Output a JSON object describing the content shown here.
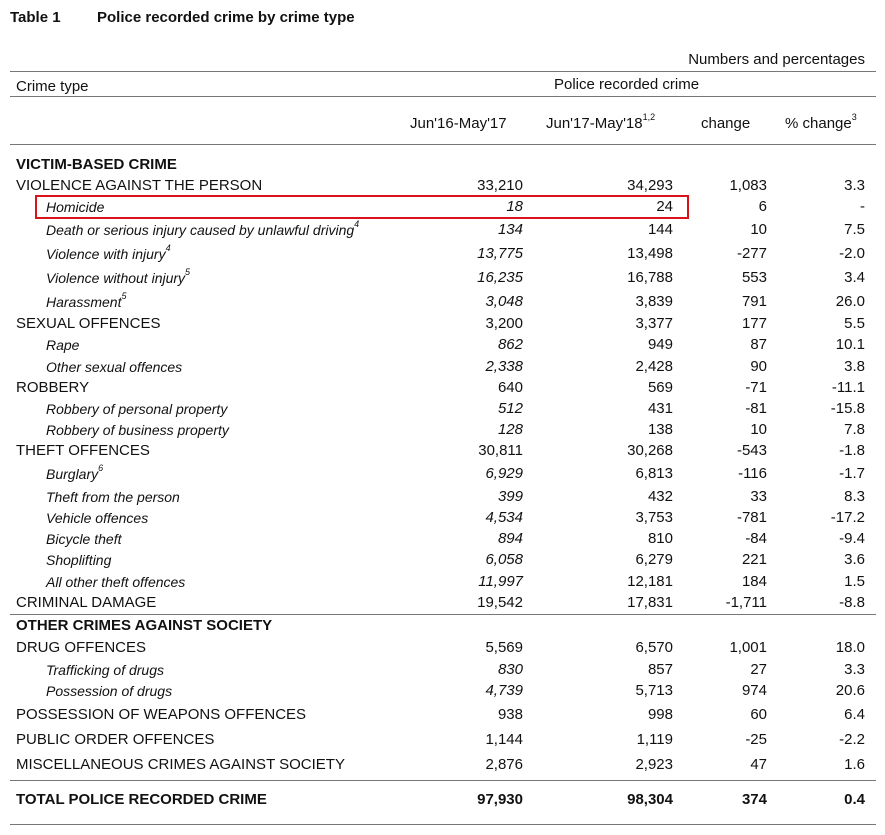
{
  "header": {
    "table_label": "Table 1",
    "title": "Police recorded crime by crime type",
    "units": "Numbers and percentages",
    "crime_type_label": "Crime type",
    "group_label": "Police recorded crime",
    "columns": {
      "col1": "Jun'16-May'17",
      "col2": "Jun'17-May'18",
      "col2_sup": "1,2",
      "col3": "change",
      "col4": "% change",
      "col4_sup": "3"
    }
  },
  "rows": [
    {
      "label": "VICTIM-BASED CRIME",
      "sup": "",
      "kind": "section"
    },
    {
      "label": "VIOLENCE AGAINST THE PERSON",
      "sup": "",
      "kind": "main",
      "v": [
        "33,210",
        "34,293",
        "1,083",
        "3.3"
      ]
    },
    {
      "label": "Homicide",
      "sup": "",
      "kind": "sub",
      "v": [
        "18",
        "24",
        "6",
        "-"
      ],
      "highlighted": true
    },
    {
      "label": "Death or serious injury caused by unlawful driving",
      "sup": "4",
      "kind": "sub",
      "v": [
        "134",
        "144",
        "10",
        "7.5"
      ]
    },
    {
      "label": "Violence with injury",
      "sup": "4",
      "kind": "sub",
      "v": [
        "13,775",
        "13,498",
        "-277",
        "-2.0"
      ]
    },
    {
      "label": "Violence without injury",
      "sup": "5",
      "kind": "sub",
      "v": [
        "16,235",
        "16,788",
        "553",
        "3.4"
      ]
    },
    {
      "label": "Harassment",
      "sup": "5",
      "kind": "sub",
      "v": [
        "3,048",
        "3,839",
        "791",
        "26.0"
      ]
    },
    {
      "label": "SEXUAL OFFENCES",
      "sup": "",
      "kind": "main",
      "v": [
        "3,200",
        "3,377",
        "177",
        "5.5"
      ]
    },
    {
      "label": "Rape",
      "sup": "",
      "kind": "sub",
      "v": [
        "862",
        "949",
        "87",
        "10.1"
      ]
    },
    {
      "label": "Other sexual offences",
      "sup": "",
      "kind": "sub",
      "v": [
        "2,338",
        "2,428",
        "90",
        "3.8"
      ]
    },
    {
      "label": "ROBBERY",
      "sup": "",
      "kind": "main",
      "v": [
        "640",
        "569",
        "-71",
        "-11.1"
      ]
    },
    {
      "label": "Robbery of personal property",
      "sup": "",
      "kind": "sub",
      "v": [
        "512",
        "431",
        "-81",
        "-15.8"
      ]
    },
    {
      "label": "Robbery of business property",
      "sup": "",
      "kind": "sub",
      "v": [
        "128",
        "138",
        "10",
        "7.8"
      ]
    },
    {
      "label": "THEFT OFFENCES",
      "sup": "",
      "kind": "main",
      "v": [
        "30,811",
        "30,268",
        "-543",
        "-1.8"
      ]
    },
    {
      "label": "Burglary",
      "sup": "6",
      "kind": "sub",
      "v": [
        "6,929",
        "6,813",
        "-116",
        "-1.7"
      ]
    },
    {
      "label": "Theft from the person",
      "sup": "",
      "kind": "sub",
      "v": [
        "399",
        "432",
        "33",
        "8.3"
      ]
    },
    {
      "label": "Vehicle offences",
      "sup": "",
      "kind": "sub",
      "v": [
        "4,534",
        "3,753",
        "-781",
        "-17.2"
      ]
    },
    {
      "label": "Bicycle theft",
      "sup": "",
      "kind": "sub",
      "v": [
        "894",
        "810",
        "-84",
        "-9.4"
      ]
    },
    {
      "label": "Shoplifting",
      "sup": "",
      "kind": "sub",
      "v": [
        "6,058",
        "6,279",
        "221",
        "3.6"
      ]
    },
    {
      "label": "All other theft offences",
      "sup": "",
      "kind": "sub",
      "v": [
        "11,997",
        "12,181",
        "184",
        "1.5"
      ]
    },
    {
      "label": "CRIMINAL DAMAGE",
      "sup": "",
      "kind": "main",
      "v": [
        "19,542",
        "17,831",
        "-1,711",
        "-8.8"
      ]
    },
    {
      "label": "OTHER CRIMES AGAINST SOCIETY",
      "sup": "",
      "kind": "section"
    },
    {
      "label": "DRUG OFFENCES",
      "sup": "",
      "kind": "main",
      "v": [
        "5,569",
        "6,570",
        "1,001",
        "18.0"
      ]
    },
    {
      "label": "Trafficking of drugs",
      "sup": "",
      "kind": "sub",
      "v": [
        "830",
        "857",
        "27",
        "3.3"
      ]
    },
    {
      "label": "Possession of drugs",
      "sup": "",
      "kind": "sub",
      "v": [
        "4,739",
        "5,713",
        "974",
        "20.6"
      ]
    },
    {
      "label": "POSSESSION OF WEAPONS OFFENCES",
      "sup": "",
      "kind": "main",
      "v": [
        "938",
        "998",
        "60",
        "6.4"
      ]
    },
    {
      "label": "PUBLIC ORDER OFFENCES",
      "sup": "",
      "kind": "main",
      "v": [
        "1,144",
        "1,119",
        "-25",
        "-2.2"
      ]
    },
    {
      "label": "MISCELLANEOUS CRIMES AGAINST SOCIETY",
      "sup": "",
      "kind": "main",
      "v": [
        "2,876",
        "2,923",
        "47",
        "1.6"
      ]
    },
    {
      "label": "TOTAL POLICE RECORDED CRIME",
      "sup": "",
      "kind": "total",
      "v": [
        "97,930",
        "98,304",
        "374",
        "0.4"
      ]
    }
  ],
  "highlight_color": "#d9121b"
}
